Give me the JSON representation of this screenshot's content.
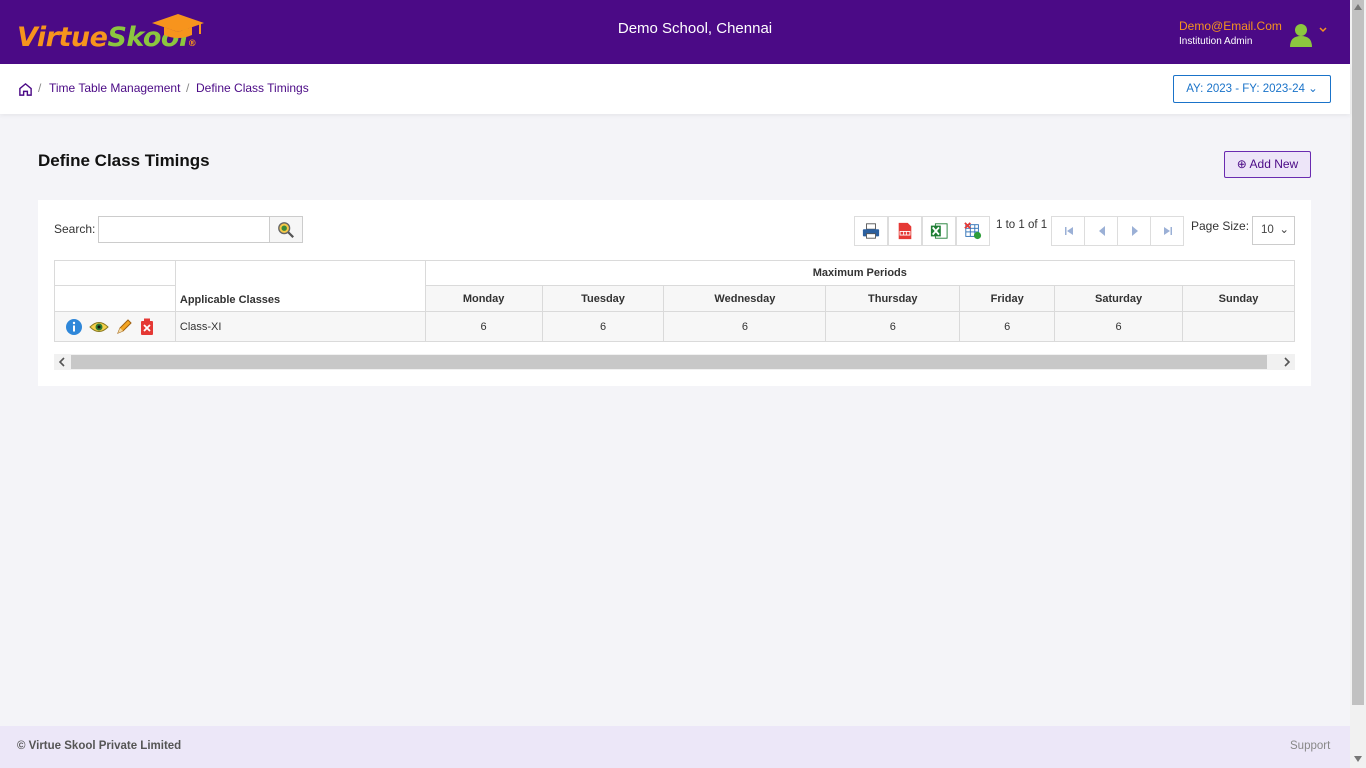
{
  "header": {
    "logo": {
      "part1": "Virtue",
      "part2": "Skool",
      "reg": "®"
    },
    "school_name": "Demo School, Chennai",
    "user_email": "Demo@Email.Com",
    "user_role": "Institution Admin"
  },
  "breadcrumb": {
    "items": [
      "Time Table Management",
      "Define Class Timings"
    ],
    "separator": "/"
  },
  "academic_year": "AY: 2023 - FY: 2023-24",
  "page": {
    "title": "Define Class Timings",
    "add_new_label": "Add New"
  },
  "toolbar": {
    "search_label": "Search:",
    "search_value": "",
    "pager_text": "1 to 1 of 1",
    "page_size_label": "Page Size:",
    "page_size_value": "10"
  },
  "table": {
    "group_header": "Maximum Periods",
    "class_header": "Applicable Classes",
    "days": [
      "Monday",
      "Tuesday",
      "Wednesday",
      "Thursday",
      "Friday",
      "Saturday",
      "Sunday"
    ],
    "rows": [
      {
        "class": "Class-XI",
        "periods": [
          "6",
          "6",
          "6",
          "6",
          "6",
          "6",
          ""
        ]
      }
    ]
  },
  "footer": {
    "copyright": "© Virtue Skool Private Limited",
    "support": "Support"
  },
  "colors": {
    "header_bg": "#4b0a86",
    "accent_orange": "#f7941d",
    "accent_green": "#8cc63f",
    "link_blue": "#1a73c9"
  }
}
